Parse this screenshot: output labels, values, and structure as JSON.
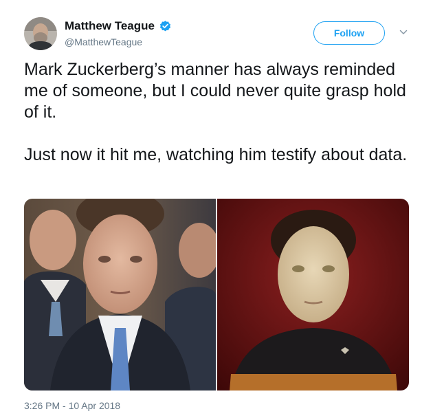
{
  "author": {
    "display_name": "Matthew Teague",
    "handle": "@MatthewTeague",
    "verified": true,
    "avatar_icon": "user-avatar"
  },
  "actions": {
    "follow_label": "Follow",
    "more_icon": "chevron-down-icon"
  },
  "tweet": {
    "paragraphs": [
      "Mark Zuckerberg’s manner has always reminded me of someone, but I could never quite grasp hold of it.",
      "Just now it hit me, watching him testify about data."
    ],
    "timestamp": "3:26 PM - 10 Apr 2018"
  },
  "media": {
    "left_photo": "man-in-suit-photo",
    "right_photo": "android-character-photo"
  },
  "colors": {
    "accent": "#1da1f2",
    "text_primary": "#14171a",
    "text_secondary": "#657786"
  }
}
